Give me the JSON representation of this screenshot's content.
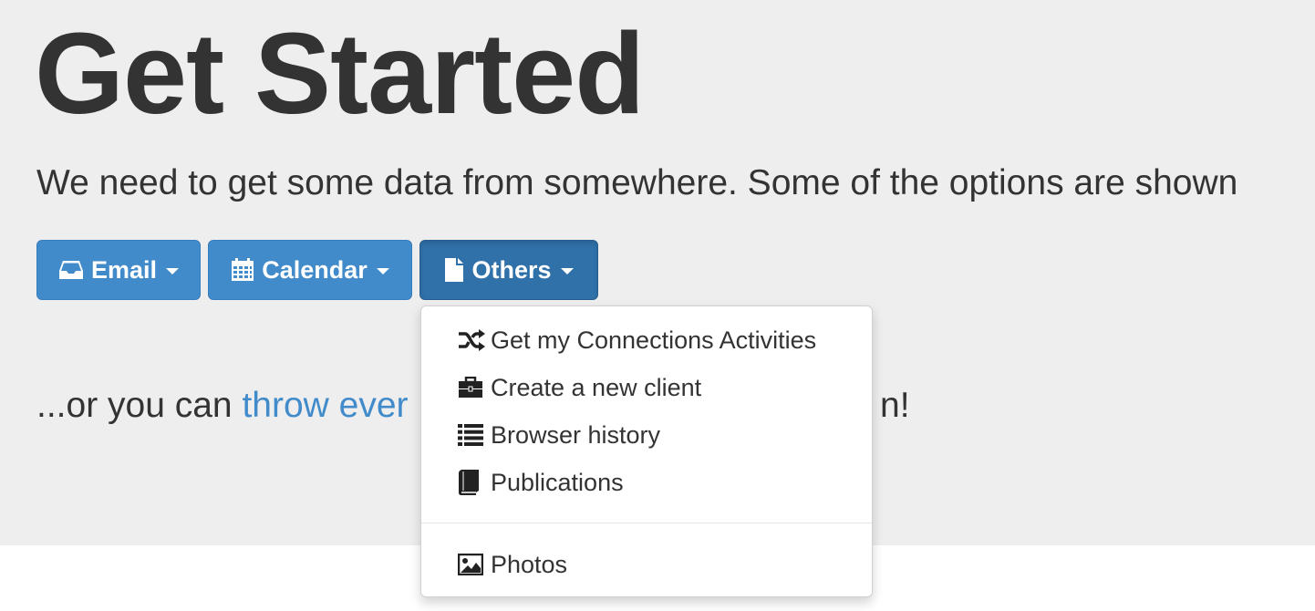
{
  "page": {
    "title": "Get Started",
    "lead": "We need to get some data from somewhere. Some of the options are shown",
    "secondary_prefix": "...or you can ",
    "secondary_link": "throw ever",
    "secondary_suffix": "n!"
  },
  "buttons": {
    "email": {
      "label": "Email",
      "icon": "inbox-icon"
    },
    "calendar": {
      "label": "Calendar",
      "icon": "calendar-icon"
    },
    "others": {
      "label": "Others",
      "icon": "file-icon",
      "state": "open"
    }
  },
  "dropdown": {
    "items": [
      {
        "label": "Get my Connections Activities",
        "icon": "shuffle-icon"
      },
      {
        "label": "Create a new client",
        "icon": "briefcase-icon"
      },
      {
        "label": "Browser history",
        "icon": "list-icon"
      },
      {
        "label": "Publications",
        "icon": "book-icon"
      },
      {
        "label": "Photos",
        "icon": "picture-icon"
      }
    ]
  },
  "colors": {
    "primary": "#428bca",
    "primary_active": "#3071a9",
    "jumbotron_bg": "#eeeeee",
    "text": "#333333",
    "link": "#428bca"
  }
}
